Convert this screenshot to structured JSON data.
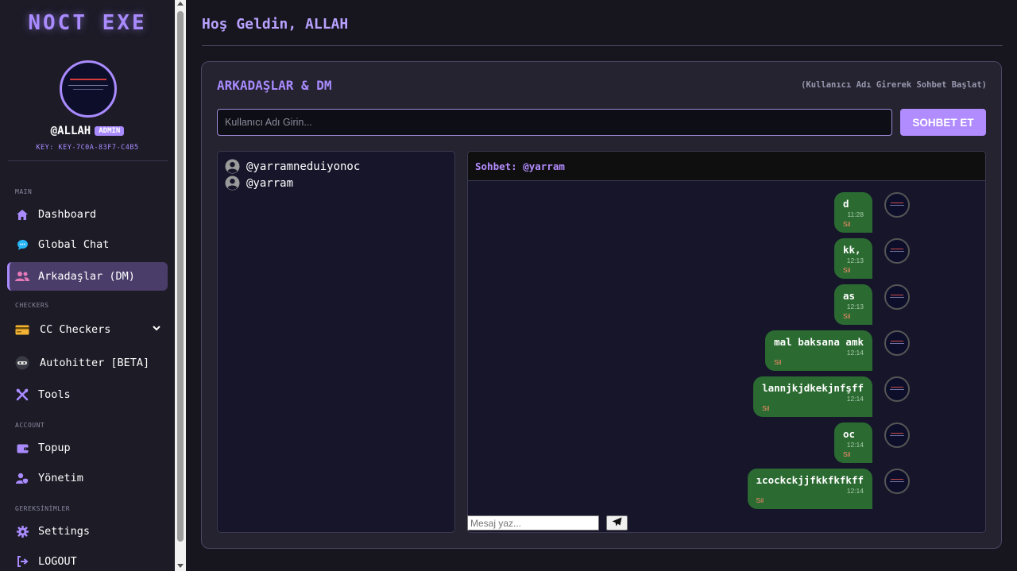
{
  "brand": "NOCT EXE",
  "user": {
    "handle": "@ALLAH",
    "badge": "ADMIN",
    "key": "KEY: KEY-7C0A-83F7-C4B5"
  },
  "sections": {
    "main": "MAIN",
    "checkers": "CHECKERS",
    "account": "ACCOUNT",
    "gereksinimler": "GEREKSİNİMLER"
  },
  "nav": {
    "dashboard": "Dashboard",
    "global_chat": "Global Chat",
    "arkadaslar": "Arkadaşlar (DM)",
    "cc_checkers": "CC Checkers",
    "autohitter": "Autohitter [BETA]",
    "tools": "Tools",
    "topup": "Topup",
    "yonetim": "Yönetim",
    "settings": "Settings",
    "logout": "LOGOUT"
  },
  "welcome": "Hoş Geldin, ALLAH",
  "panel": {
    "title": "ARKADAŞLAR & DM",
    "hint": "(Kullanıcı Adı Girerek Sohbet Başlat)",
    "username_placeholder": "Kullanıcı Adı Girin...",
    "start_button": "SOHBET ET"
  },
  "friends": [
    "@yarramneduiyonoc",
    "@yarram"
  ],
  "chat": {
    "title": "Sohbet: @yarram",
    "delete_label": "Sil",
    "input_placeholder": "Mesaj yaz...",
    "messages": [
      {
        "text": "d",
        "time": "11:28"
      },
      {
        "text": "kk,",
        "time": "12:13"
      },
      {
        "text": "as",
        "time": "12:13"
      },
      {
        "text": "mal baksana amk",
        "time": "12:14"
      },
      {
        "text": "lannjkjdkekjnfşff",
        "time": "12:14"
      },
      {
        "text": "oc",
        "time": "12:14"
      },
      {
        "text": "ıcockckjjfkkfkfkff",
        "time": "12:14"
      }
    ]
  },
  "colors": {
    "accent": "#a98bff",
    "button": "#b18cff",
    "message_bubble": "#2b6b32",
    "background": "#17161f"
  }
}
